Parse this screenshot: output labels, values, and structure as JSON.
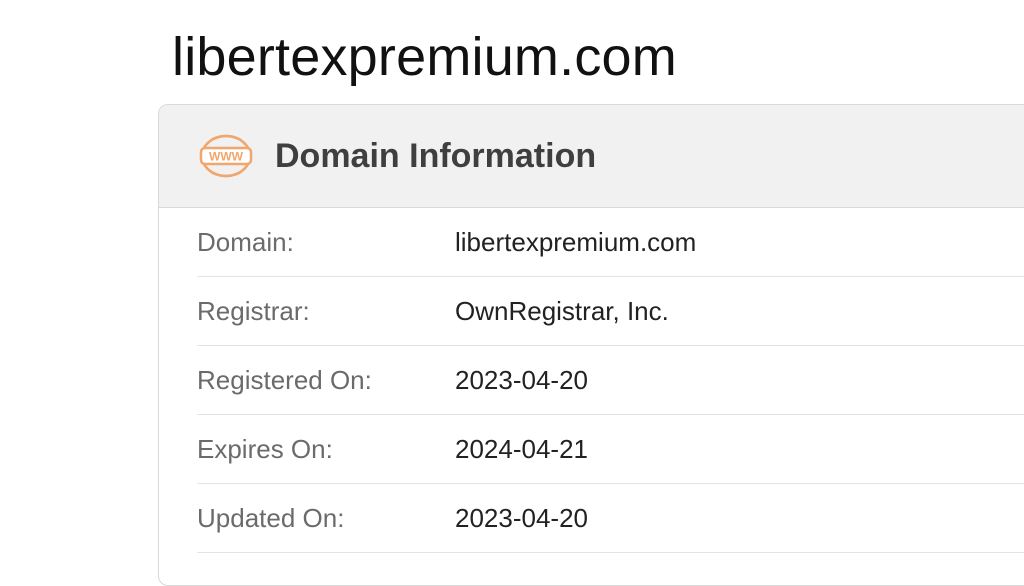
{
  "page": {
    "title": "libertexpremium.com"
  },
  "card": {
    "icon": "www-globe-icon",
    "icon_text": "WWW",
    "accent_color": "#f0a66c",
    "title": "Domain Information",
    "rows": [
      {
        "label": "Domain:",
        "value": "libertexpremium.com"
      },
      {
        "label": "Registrar:",
        "value": "OwnRegistrar, Inc."
      },
      {
        "label": "Registered On:",
        "value": "2023-04-20"
      },
      {
        "label": "Expires On:",
        "value": "2024-04-21"
      },
      {
        "label": "Updated On:",
        "value": "2023-04-20"
      }
    ]
  }
}
